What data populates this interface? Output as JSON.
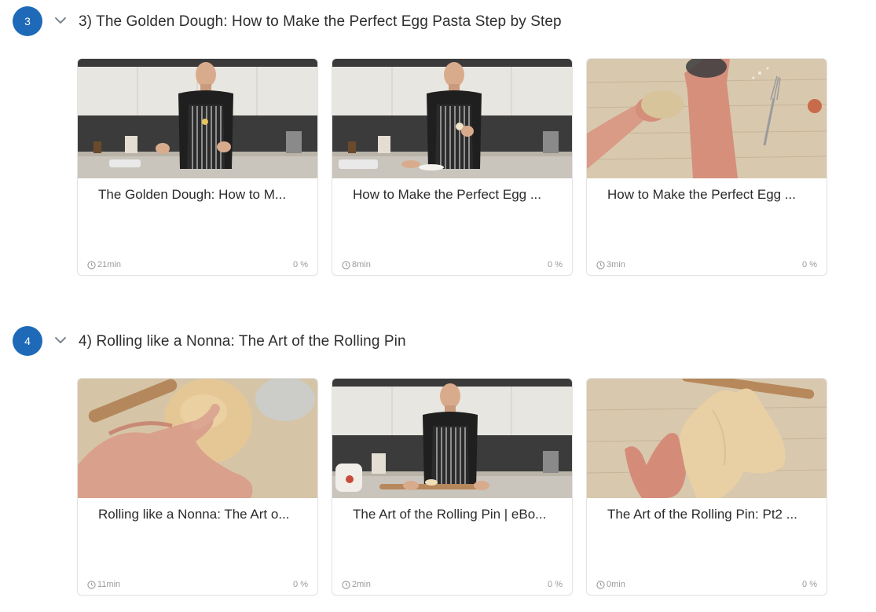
{
  "sections": [
    {
      "number": "3",
      "title": "3) The Golden Dough: How to Make the Perfect Egg Pasta Step by Step",
      "lessons": [
        {
          "title": "The Golden Dough: How to M...",
          "duration": "21min",
          "progress": "0 %"
        },
        {
          "title": "How to Make the Perfect Egg ...",
          "duration": "8min",
          "progress": "0 %"
        },
        {
          "title": "How to Make the Perfect Egg ...",
          "duration": "3min",
          "progress": "0 %"
        }
      ]
    },
    {
      "number": "4",
      "title": "4) Rolling like a Nonna: The Art of the Rolling Pin",
      "lessons": [
        {
          "title": "Rolling like a Nonna: The Art o...",
          "duration": "11min",
          "progress": "0 %"
        },
        {
          "title": "The Art of the Rolling Pin | eBo...",
          "duration": "2min",
          "progress": "0 %"
        },
        {
          "title": "The Art of the Rolling Pin: Pt2 ...",
          "duration": "0min",
          "progress": "0 %"
        }
      ]
    }
  ],
  "colors": {
    "badge": "#1e6ab8",
    "text": "#2b2b2b",
    "muted": "#9a9a9a",
    "border": "#e4e4e4"
  }
}
